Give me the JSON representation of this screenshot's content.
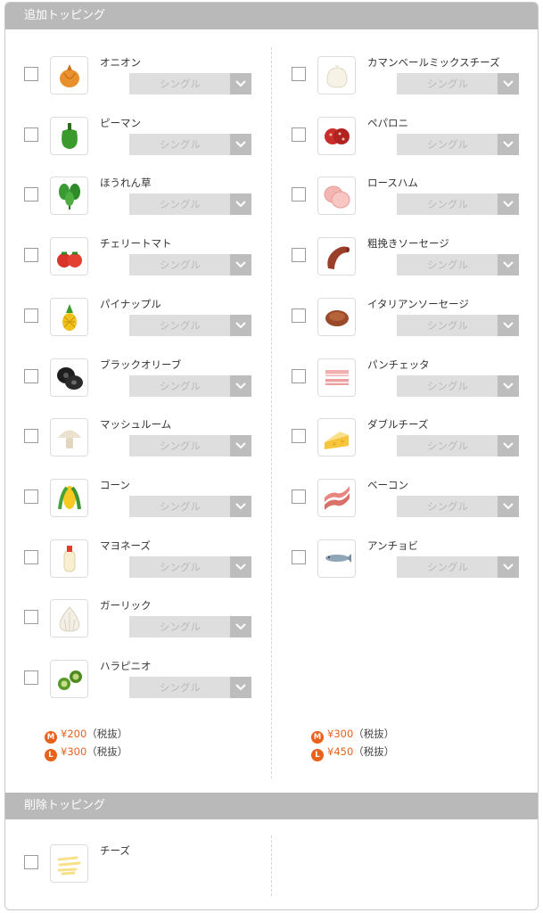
{
  "sections": {
    "add_title": "追加トッピング",
    "remove_title": "削除トッピング"
  },
  "select_default": "シングル",
  "add_left": [
    {
      "name": "オニオン",
      "icon": "onion-icon"
    },
    {
      "name": "ピーマン",
      "icon": "green-pepper-icon"
    },
    {
      "name": "ほうれん草",
      "icon": "spinach-icon"
    },
    {
      "name": "チェリートマト",
      "icon": "cherry-tomato-icon"
    },
    {
      "name": "パイナップル",
      "icon": "pineapple-icon"
    },
    {
      "name": "ブラックオリーブ",
      "icon": "black-olive-icon"
    },
    {
      "name": "マッシュルーム",
      "icon": "mushroom-icon"
    },
    {
      "name": "コーン",
      "icon": "corn-icon"
    },
    {
      "name": "マヨネーズ",
      "icon": "mayonnaise-icon"
    },
    {
      "name": "ガーリック",
      "icon": "garlic-icon"
    },
    {
      "name": "ハラピニオ",
      "icon": "jalapeno-icon"
    }
  ],
  "add_right": [
    {
      "name": "カマンベールミックスチーズ",
      "icon": "camembert-icon"
    },
    {
      "name": "ペパロニ",
      "icon": "pepperoni-icon"
    },
    {
      "name": "ロースハム",
      "icon": "ham-icon"
    },
    {
      "name": "粗挽きソーセージ",
      "icon": "sausage-icon"
    },
    {
      "name": "イタリアンソーセージ",
      "icon": "italian-sausage-icon"
    },
    {
      "name": "パンチェッタ",
      "icon": "pancetta-icon"
    },
    {
      "name": "ダブルチーズ",
      "icon": "double-cheese-icon"
    },
    {
      "name": "ベーコン",
      "icon": "bacon-icon"
    },
    {
      "name": "アンチョビ",
      "icon": "anchovy-icon"
    }
  ],
  "prices_left": {
    "m_badge": "M",
    "m_amount": "¥200",
    "m_tax": "（税抜）",
    "l_badge": "L",
    "l_amount": "¥300",
    "l_tax": "（税抜）"
  },
  "prices_right": {
    "m_badge": "M",
    "m_amount": "¥300",
    "m_tax": "（税抜）",
    "l_badge": "L",
    "l_amount": "¥450",
    "l_tax": "（税抜）"
  },
  "remove_items": [
    {
      "name": "チーズ",
      "icon": "cheese-icon"
    }
  ],
  "colors": {
    "header_bg": "#b9b9b9",
    "price_accent": "#e8621c",
    "select_bg": "#dedede",
    "select_chevron_bg": "#bdbdbd"
  }
}
